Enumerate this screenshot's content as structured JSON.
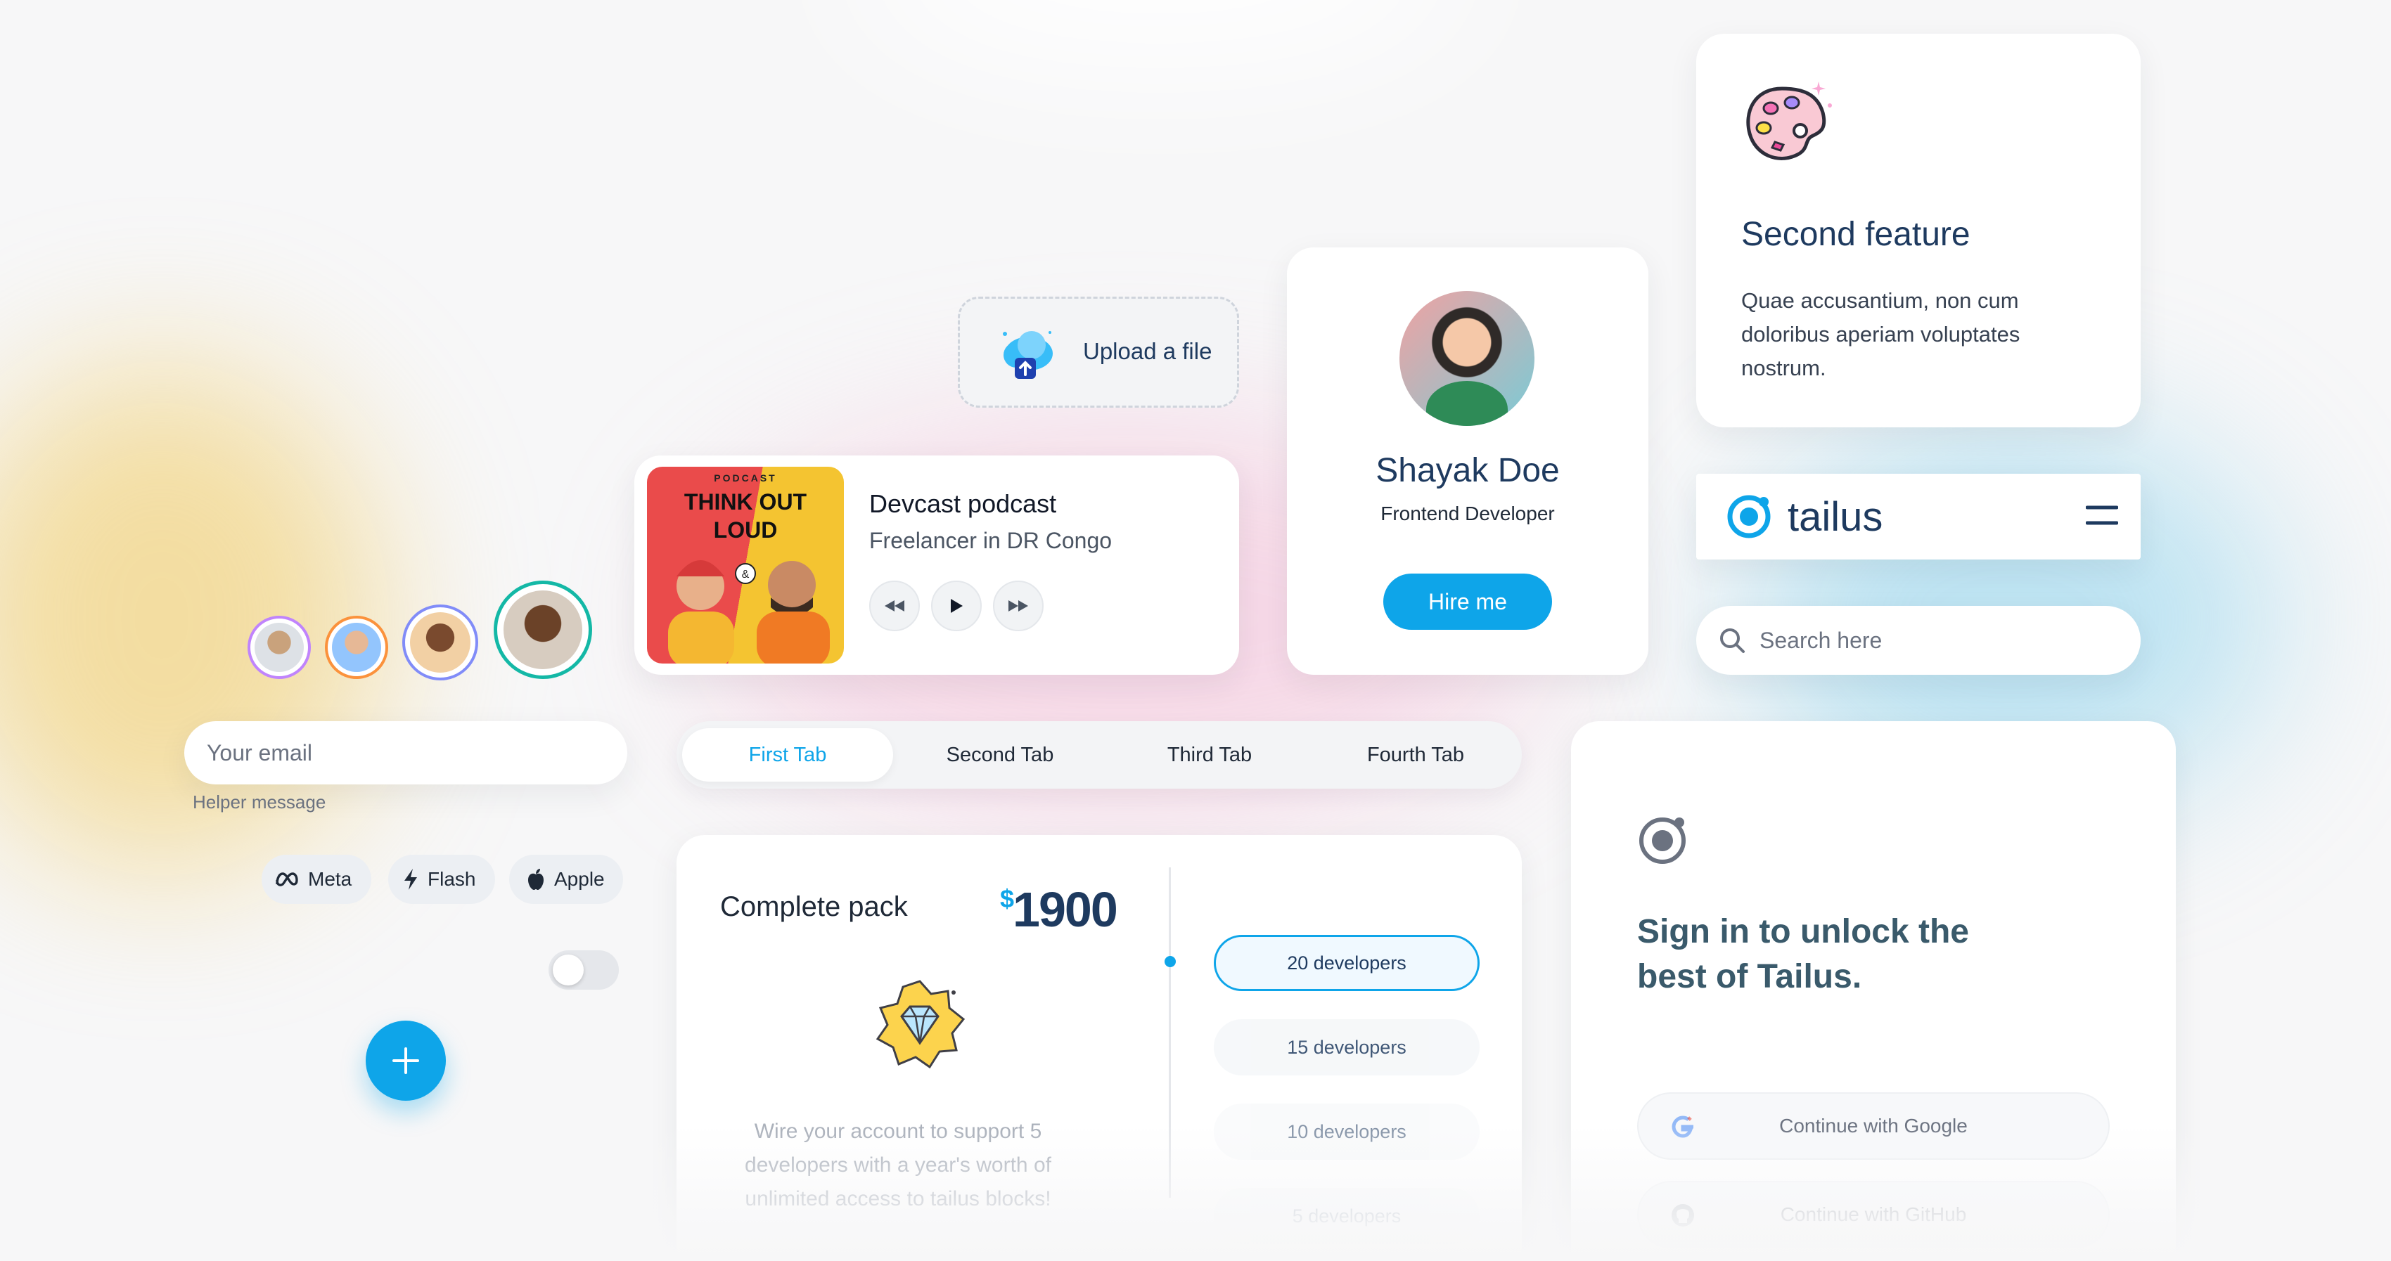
{
  "colors": {
    "accent": "#0ea5e9",
    "heading": "#1e3a5f",
    "background": "#f7f7f8"
  },
  "upload": {
    "label": "Upload a file",
    "icon": "cloud-upload-icon"
  },
  "podcast": {
    "cover": {
      "small": "PODCAST",
      "big_line1": "THINK OUT",
      "big_line2": "LOUD"
    },
    "title": "Devcast podcast",
    "subtitle": "Freelancer in DR Congo",
    "controls": [
      "rewind-icon",
      "play-icon",
      "fast-forward-icon"
    ]
  },
  "profile": {
    "name": "Shayak Doe",
    "role": "Frontend Developer",
    "cta": "Hire me"
  },
  "feature": {
    "icon": "palette-icon",
    "title": "Second feature",
    "text": "Quae accusantium, non cum doloribus aperiam voluptates nostrum."
  },
  "navbar": {
    "brand": "tailus",
    "menu_icon": "hamburger-menu-icon"
  },
  "search": {
    "placeholder": "Search here"
  },
  "avatars": {
    "count": 4
  },
  "email": {
    "placeholder": "Your email",
    "helper": "Helper message"
  },
  "chips": [
    {
      "label": "Meta",
      "icon": "meta-icon"
    },
    {
      "label": "Flash",
      "icon": "flash-icon"
    },
    {
      "label": "Apple",
      "icon": "apple-icon"
    }
  ],
  "toggle": {
    "checked": false
  },
  "fab": {
    "icon": "plus-icon"
  },
  "tabs": {
    "items": [
      "First Tab",
      "Second Tab",
      "Third Tab",
      "Fourth Tab"
    ],
    "active": 0
  },
  "pricing": {
    "title": "Complete pack",
    "currency": "$",
    "amount": "1900",
    "description": "Wire your account to support 5 developers with a year's worth of unlimited access to tailus blocks!",
    "options": [
      "20 developers",
      "15 developers",
      "10 developers",
      "5 developers"
    ],
    "selected": 0
  },
  "signin": {
    "title_line1": "Sign in to unlock the",
    "title_line2": "best of Tailus.",
    "google": "Continue with Google",
    "github": "Continue with GitHub"
  }
}
